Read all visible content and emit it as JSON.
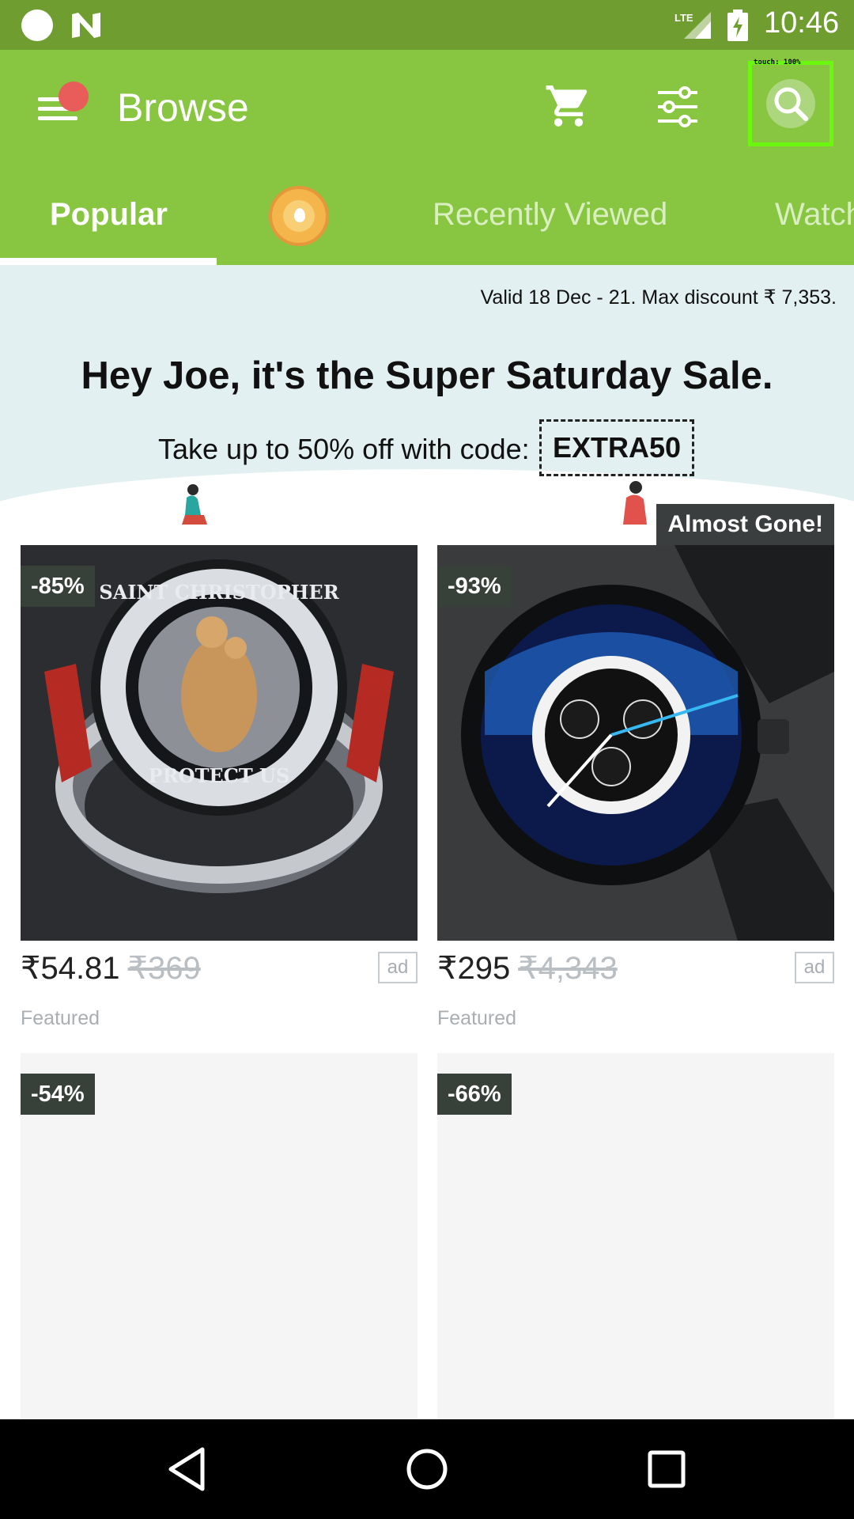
{
  "status_bar": {
    "time": "10:46",
    "network": "LTE",
    "icons": [
      "circle-icon",
      "n-logo-icon",
      "lte-signal-icon",
      "battery-charging-icon"
    ]
  },
  "app_bar": {
    "title": "Browse",
    "touch_overlay": "touch: 100%",
    "icons": [
      "menu-icon",
      "cart-icon",
      "filter-icon",
      "search-icon"
    ],
    "accent_color": "#88c540",
    "notification_color": "#e85c59"
  },
  "tabs": [
    {
      "label": "Popular",
      "active": true
    },
    {
      "label": "Recently Viewed",
      "active": false
    },
    {
      "label": "Watch",
      "active": false
    }
  ],
  "promo": {
    "valid_text": "Valid 18 Dec - 21. Max discount ₹ 7,353.",
    "headline": "Hey Joe, it's the Super Saturday Sale.",
    "subtext": "Take up to 50% off with code:",
    "code": "EXTRA50"
  },
  "products": [
    {
      "discount": "-85%",
      "price": "₹54.81",
      "old_price": "₹369",
      "ad_label": "ad",
      "featured": "Featured",
      "image": "saint-christopher-ring"
    },
    {
      "discount": "-93%",
      "price": "₹295",
      "old_price": "₹4,343",
      "ad_label": "ad",
      "featured": "Featured",
      "image": "black-chronograph-watch",
      "flag": "Almost Gone!"
    },
    {
      "discount": "-54%"
    },
    {
      "discount": "-66%"
    }
  ],
  "nav_bar": {
    "icons": [
      "back-icon",
      "home-icon",
      "recents-icon"
    ]
  }
}
